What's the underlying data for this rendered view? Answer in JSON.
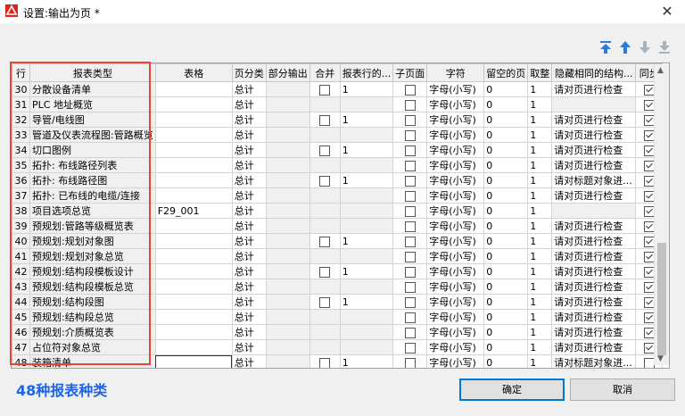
{
  "window": {
    "title": "设置:输出为页 *",
    "close_label": "✕"
  },
  "toolbar": {
    "icons": [
      "move-top-icon",
      "move-up-icon",
      "move-down-icon",
      "move-bottom-icon"
    ]
  },
  "grid": {
    "headers": [
      "行",
      "报表类型",
      "表格",
      "页分类",
      "部分输出",
      "合并",
      "报表行的...",
      "子页面",
      "字符",
      "留空的页",
      "取整",
      "隐藏相同的结构...",
      "同步"
    ],
    "rows": [
      {
        "row": "30",
        "type": "分散设备清单",
        "table": "",
        "page": "总计",
        "merge": false,
        "lines": "1",
        "sub": false,
        "char": "字母(小写)",
        "blank": "0",
        "round": "1",
        "hide": "请对页进行检查",
        "sync": true
      },
      {
        "row": "31",
        "type": "PLC 地址概览",
        "table": "",
        "page": "总计",
        "merge": null,
        "lines": "",
        "sub": false,
        "char": "字母(小写)",
        "blank": "0",
        "round": "1",
        "hide": "",
        "sync": true
      },
      {
        "row": "32",
        "type": "导管/电线图",
        "table": "",
        "page": "总计",
        "merge": false,
        "lines": "1",
        "sub": false,
        "char": "字母(小写)",
        "blank": "0",
        "round": "1",
        "hide": "请对页进行检查",
        "sync": true
      },
      {
        "row": "33",
        "type": "管道及仪表流程图:管路概览",
        "table": "",
        "page": "总计",
        "merge": null,
        "lines": "",
        "sub": false,
        "char": "字母(小写)",
        "blank": "0",
        "round": "1",
        "hide": "请对页进行检查",
        "sync": true
      },
      {
        "row": "34",
        "type": "切口图例",
        "table": "",
        "page": "总计",
        "merge": false,
        "lines": "1",
        "sub": false,
        "char": "字母(小写)",
        "blank": "0",
        "round": "1",
        "hide": "请对页进行检查",
        "sync": true
      },
      {
        "row": "35",
        "type": "拓扑: 布线路径列表",
        "table": "",
        "page": "总计",
        "merge": null,
        "lines": "",
        "sub": false,
        "char": "字母(小写)",
        "blank": "0",
        "round": "1",
        "hide": "请对页进行检查",
        "sync": true
      },
      {
        "row": "36",
        "type": "拓扑: 布线路径图",
        "table": "",
        "page": "总计",
        "merge": false,
        "lines": "1",
        "sub": false,
        "char": "字母(小写)",
        "blank": "0",
        "round": "1",
        "hide": "请对标题对象进...",
        "sync": true
      },
      {
        "row": "37",
        "type": "拓扑: 已布线的电缆/连接",
        "table": "",
        "page": "总计",
        "merge": null,
        "lines": "",
        "sub": false,
        "char": "字母(小写)",
        "blank": "0",
        "round": "1",
        "hide": "请对页进行检查",
        "sync": true
      },
      {
        "row": "38",
        "type": "项目选项总览",
        "table": "F29_001",
        "page": "总计",
        "merge": null,
        "lines": "",
        "sub": false,
        "char": "字母(小写)",
        "blank": "0",
        "round": "1",
        "hide": "",
        "sync": true
      },
      {
        "row": "39",
        "type": "预规划:管路等级概览表",
        "table": "",
        "page": "总计",
        "merge": null,
        "lines": "",
        "sub": false,
        "char": "字母(小写)",
        "blank": "0",
        "round": "1",
        "hide": "请对页进行检查",
        "sync": true
      },
      {
        "row": "40",
        "type": "预规划:规划对象图",
        "table": "",
        "page": "总计",
        "merge": false,
        "lines": "1",
        "sub": false,
        "char": "字母(小写)",
        "blank": "0",
        "round": "1",
        "hide": "请对页进行检查",
        "sync": true
      },
      {
        "row": "41",
        "type": "预规划:规划对象总览",
        "table": "",
        "page": "总计",
        "merge": null,
        "lines": "",
        "sub": false,
        "char": "字母(小写)",
        "blank": "0",
        "round": "1",
        "hide": "请对页进行检查",
        "sync": true
      },
      {
        "row": "42",
        "type": "预规划:结构段模板设计",
        "table": "",
        "page": "总计",
        "merge": false,
        "lines": "1",
        "sub": false,
        "char": "字母(小写)",
        "blank": "0",
        "round": "1",
        "hide": "请对页进行检查",
        "sync": true
      },
      {
        "row": "43",
        "type": "预规划:结构段模板总览",
        "table": "",
        "page": "总计",
        "merge": null,
        "lines": "",
        "sub": false,
        "char": "字母(小写)",
        "blank": "0",
        "round": "1",
        "hide": "请对页进行检查",
        "sync": true
      },
      {
        "row": "44",
        "type": "预规划:结构段图",
        "table": "",
        "page": "总计",
        "merge": false,
        "lines": "1",
        "sub": false,
        "char": "字母(小写)",
        "blank": "0",
        "round": "1",
        "hide": "请对页进行检查",
        "sync": true
      },
      {
        "row": "45",
        "type": "预规划:结构段总览",
        "table": "",
        "page": "总计",
        "merge": null,
        "lines": "",
        "sub": false,
        "char": "字母(小写)",
        "blank": "0",
        "round": "1",
        "hide": "请对页进行检查",
        "sync": true
      },
      {
        "row": "46",
        "type": "预规划:介质概览表",
        "table": "",
        "page": "总计",
        "merge": null,
        "lines": "",
        "sub": false,
        "char": "字母(小写)",
        "blank": "0",
        "round": "1",
        "hide": "请对页进行检查",
        "sync": true
      },
      {
        "row": "47",
        "type": "占位符对象总览",
        "table": "",
        "page": "总计",
        "merge": null,
        "lines": "",
        "sub": false,
        "char": "字母(小写)",
        "blank": "0",
        "round": "1",
        "hide": "请对页进行检查",
        "sync": true
      },
      {
        "row": "48",
        "type": "装箱清单",
        "table": "",
        "page": "总计",
        "merge": false,
        "lines": "1",
        "sub": false,
        "char": "字母(小写)",
        "blank": "0",
        "round": "1",
        "hide": "请对标题对象进...",
        "sync": false
      }
    ]
  },
  "annotation": "48种报表种类",
  "buttons": {
    "ok": "确定",
    "cancel": "取消"
  },
  "colors": {
    "annotation": "#1e64e6",
    "highlight": "#e8443a",
    "toolbar_active": "#2b7bd9",
    "toolbar_inactive": "#a9b2bd"
  }
}
